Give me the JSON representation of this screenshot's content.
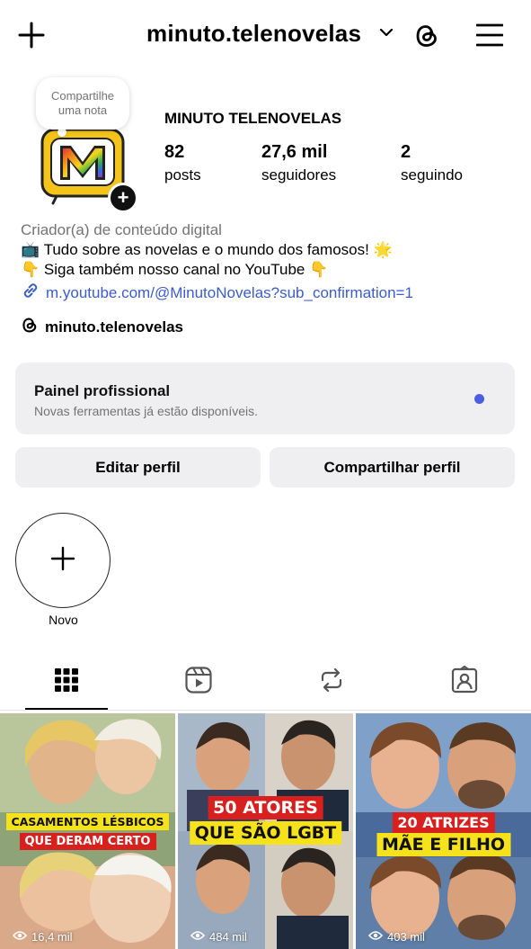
{
  "header": {
    "username": "minuto.telenovelas"
  },
  "profile": {
    "note_line1": "Compartilhe",
    "note_line2": "uma nota",
    "display_name": "MINUTO TELENOVELAS",
    "stats": [
      {
        "value": "82",
        "label": "posts"
      },
      {
        "value": "27,6 mil",
        "label": "seguidores"
      },
      {
        "value": "2",
        "label": "seguindo"
      }
    ],
    "category": "Criador(a) de conteúdo digital",
    "bio_line1": "📺 Tudo sobre as novelas e o mundo dos famosos! 🌟",
    "bio_line2": "👇 Siga também nosso canal no YouTube 👇",
    "link": "m.youtube.com/@MinutoNovelas?sub_confirmation=1",
    "threads_handle": "minuto.telenovelas"
  },
  "panel": {
    "title": "Painel profissional",
    "subtitle": "Novas ferramentas já estão disponíveis."
  },
  "buttons": {
    "edit": "Editar perfil",
    "share": "Compartilhar perfil"
  },
  "highlights": {
    "new_label": "Novo"
  },
  "tabs": [
    "grid-icon",
    "reels-icon",
    "reposts-icon",
    "tagged-icon"
  ],
  "posts": [
    {
      "caption_line1": "CASAMENTOS LÉSBICOS",
      "caption_line2": "QUE DERAM CERTO",
      "views": "16,4 mil"
    },
    {
      "caption_line1": "50 ATORES",
      "caption_line2": "QUE SÃO LGBT",
      "views": "484 mil"
    },
    {
      "caption_line1": "20 ATRIZES",
      "caption_line2": "MÃE E FILHO",
      "views": "403 mil"
    }
  ],
  "colors": {
    "link": "#3b5ccc",
    "panel_bg": "#efeff2",
    "notification_dot": "#4a5fe0",
    "caption_red": "#d8201f",
    "caption_yellow": "#f5e21a"
  }
}
